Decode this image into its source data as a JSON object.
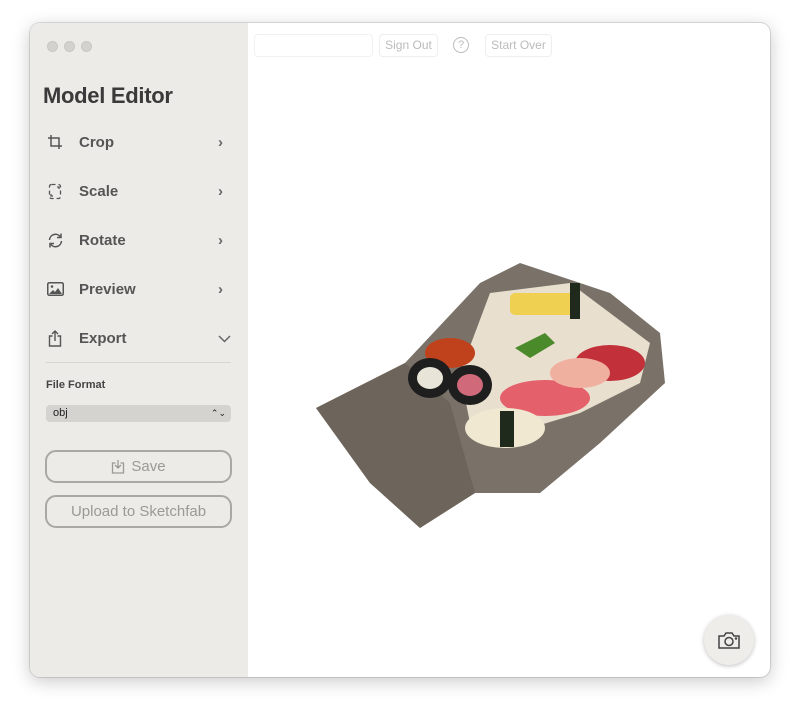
{
  "sidebar": {
    "title": "Model Editor",
    "items": [
      {
        "label": "Crop",
        "icon": "crop-icon",
        "state": "collapsed"
      },
      {
        "label": "Scale",
        "icon": "scale-icon",
        "state": "collapsed"
      },
      {
        "label": "Rotate",
        "icon": "rotate-icon",
        "state": "collapsed"
      },
      {
        "label": "Preview",
        "icon": "image-icon",
        "state": "collapsed"
      },
      {
        "label": "Export",
        "icon": "share-icon",
        "state": "expanded"
      }
    ],
    "export": {
      "file_format_label": "File Format",
      "file_format_value": "obj",
      "save_label": "Save",
      "upload_label": "Upload to Sketchfab"
    }
  },
  "toolbar": {
    "search_value": "",
    "sign_out": "Sign Out",
    "help": "?",
    "start_over": "Start Over"
  },
  "viewer": {
    "camera_icon": "camera-icon"
  }
}
